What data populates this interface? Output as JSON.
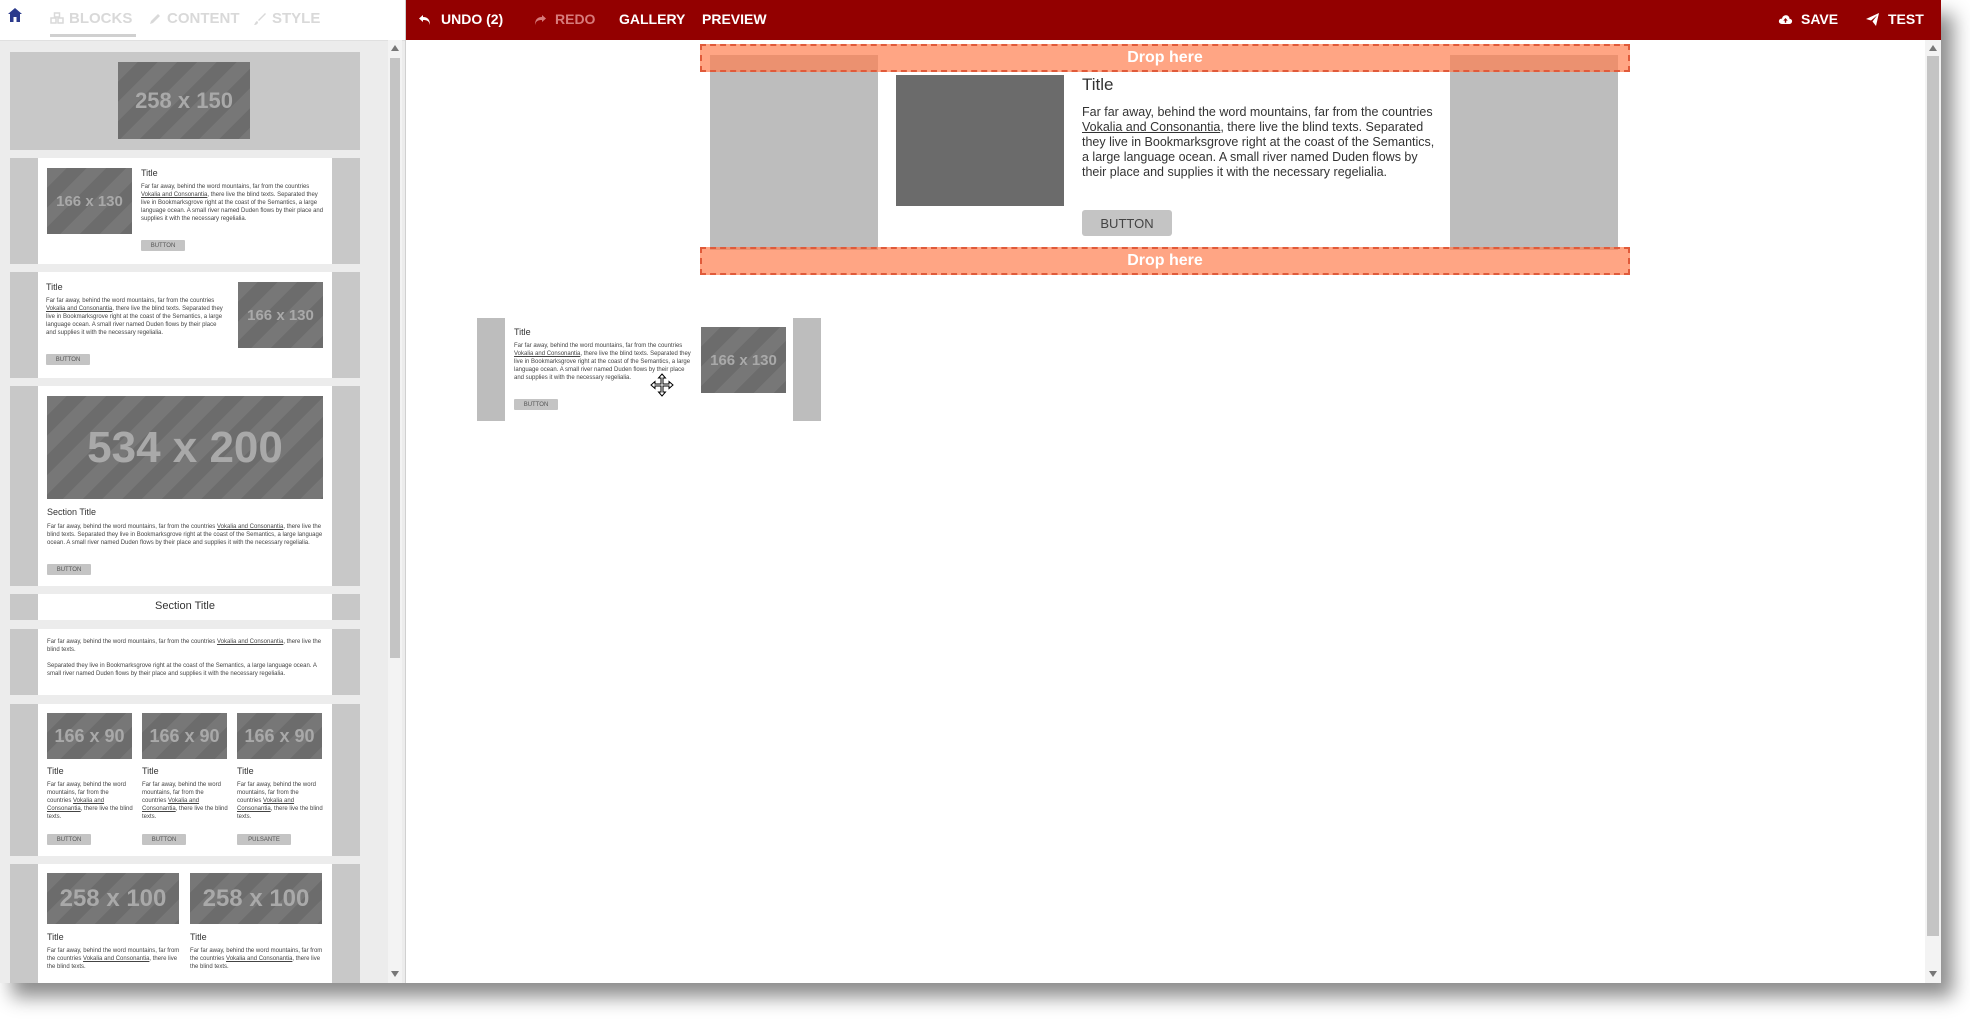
{
  "sidebar": {
    "tabs": [
      {
        "label": "BLOCKS",
        "icon": "blocks-icon"
      },
      {
        "label": "CONTENT",
        "icon": "pencil-icon"
      },
      {
        "label": "STYLE",
        "icon": "brush-icon"
      }
    ],
    "blocks": {
      "b1": {
        "placeholder": "258 x 150"
      },
      "b2": {
        "placeholder": "166 x 130",
        "title": "Title",
        "text_before": "Far far away, behind the word mountains, far from the countries ",
        "link": "Vokalia and Consonantia",
        "text_after": ", there live the blind texts. Separated they live in Bookmarksgrove right at the coast of the Semantics, a large language ocean. A small river named Duden flows by their place and supplies it with the necessary regelialia.",
        "button": "BUTTON"
      },
      "b3": {
        "placeholder": "166 x 130",
        "title": "Title",
        "text_before": "Far far away, behind the word mountains, far from the countries ",
        "link": "Vokalia and Consonantia",
        "text_after": ", there live the blind texts. Separated they live in Bookmarksgrove right at the coast of the Semantics, a large language ocean. A small river named Duden flows by their place and supplies it with the necessary regelialia.",
        "button": "BUTTON"
      },
      "b4": {
        "placeholder": "534 x 200",
        "title": "Section Title",
        "text_before": "Far far away, behind the word mountains, far from the countries ",
        "link": "Vokalia and Consonantia",
        "text_after": ", there live the blind texts. Separated they live in Bookmarksgrove right at the coast of the Semantics, a large language ocean. A small river named Duden flows by their place and supplies it with the necessary regelialia.",
        "button": "BUTTON"
      },
      "b5": {
        "title": "Section Title"
      },
      "b6": {
        "p1_before": "Far far away, behind the word mountains, far from the countries ",
        "link": "Vokalia and Consonantia",
        "p1_after": ", there live the blind texts.",
        "p2": "Separated they live in Bookmarksgrove right at the coast of the Semantics, a large language ocean. A small river named Duden flows by their place and supplies it with the necessary regelialia."
      },
      "b7": {
        "columns": [
          {
            "placeholder": "166 x 90",
            "title": "Title",
            "text_before": "Far far away, behind the word mountains, far from the countries ",
            "link": "Vokalia and Consonantia",
            "text_after": ", there live the blind texts.",
            "button": "BUTTON"
          },
          {
            "placeholder": "166 x 90",
            "title": "Title",
            "text_before": "Far far away, behind the word mountains, far from the countries ",
            "link": "Vokalia and Consonantia",
            "text_after": ", there live the blind texts.",
            "button": "BUTTON"
          },
          {
            "placeholder": "166 x 90",
            "title": "Title",
            "text_before": "Far far away, behind the word mountains, far from the countries ",
            "link": "Vokalia and Consonantia",
            "text_after": ", there live the blind texts.",
            "button": "PULSANTE"
          }
        ]
      },
      "b8": {
        "columns": [
          {
            "placeholder": "258 x 100",
            "title": "Title",
            "text_before": "Far far away, behind the word mountains, far from the countries ",
            "link": "Vokalia and Consonantia",
            "text_after": ", there live the blind texts."
          },
          {
            "placeholder": "258 x 100",
            "title": "Title",
            "text_before": "Far far away, behind the word mountains, far from the countries ",
            "link": "Vokalia and Consonantia",
            "text_after": ", there live the blind texts."
          }
        ]
      }
    }
  },
  "toolbar": {
    "undo": "UNDO (2)",
    "redo": "REDO",
    "gallery": "GALLERY",
    "preview": "PREVIEW",
    "save": "SAVE",
    "test": "TEST",
    "brand_color": "#930000"
  },
  "canvas": {
    "drop_top": "Drop here",
    "drop_bottom": "Drop here",
    "block": {
      "title": "Title",
      "text_before": "Far far away, behind the word mountains, far from the countries ",
      "link": "Vokalia and Consonantia",
      "text_after": ", there live the blind texts. Separated they live in Bookmarksgrove right at the coast of the Semantics, a large language ocean. A small river named Duden flows by their place and supplies it with the necessary regelialia.",
      "button": "BUTTON"
    },
    "dragging": {
      "placeholder": "166 x 130",
      "title": "Title",
      "text_before": "Far far away, behind the word mountains, far from the countries ",
      "link": "Vokalia and Consonantia",
      "text_after": ", there live the blind texts. Separated they live in Bookmarksgrove right at the coast of the Semantics, a large language ocean. A small river named Duden flows by their place and supplies it with the necessary regelialia.",
      "button": "BUTTON"
    }
  }
}
